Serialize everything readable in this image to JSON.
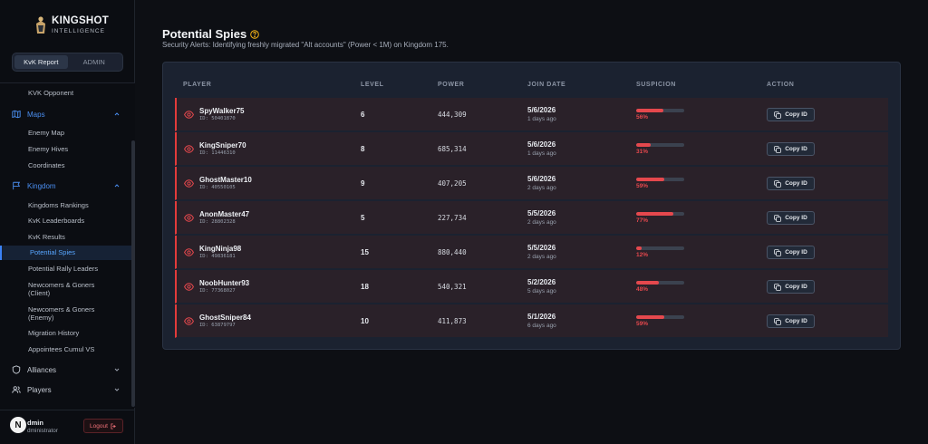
{
  "brand": {
    "line1": "KINGSHOT",
    "line2": "INTELLIGENCE"
  },
  "mode_switch": {
    "kvk_report": "KvK Report",
    "admin": "ADMIN"
  },
  "sidebar": {
    "kvk_opponent": "KVK Opponent",
    "maps": {
      "label": "Maps",
      "items": [
        "Enemy Map",
        "Enemy Hives",
        "Coordinates"
      ]
    },
    "kingdom": {
      "label": "Kingdom",
      "items": [
        "Kingdoms Rankings",
        "KvK Leaderboards",
        "KvK Results",
        "Potential Spies",
        "Potential Rally Leaders",
        "Newcomers & Goners",
        "(Client)",
        "Newcomers & Goners",
        "(Enemy)",
        "Migration History",
        "Appointees Cumul VS"
      ]
    },
    "alliances": "Alliances",
    "players": "Players"
  },
  "user": {
    "avatar": "N",
    "name": "dmin",
    "role": "dministrator",
    "logout": "Logout"
  },
  "page": {
    "title": "Potential Spies",
    "subtitle": "Security Alerts: Identifying freshly migrated \"Alt accounts\" (Power < 1M) on Kingdom 175."
  },
  "table": {
    "headers": [
      "PLAYER",
      "LEVEL",
      "POWER",
      "JOIN DATE",
      "SUSPICION",
      "ACTION"
    ],
    "copy_label": "Copy ID",
    "rows": [
      {
        "name": "SpyWalker75",
        "id": "ID: 50401870",
        "level": "6",
        "power": "444,309",
        "date": "5/6/2026",
        "ago": "1 days ago",
        "suspicion": 56,
        "suspicion_label": "56%"
      },
      {
        "name": "KingSniper70",
        "id": "ID: 11446310",
        "level": "8",
        "power": "685,314",
        "date": "5/6/2026",
        "ago": "1 days ago",
        "suspicion": 31,
        "suspicion_label": "31%"
      },
      {
        "name": "GhostMaster10",
        "id": "ID: 40550105",
        "level": "9",
        "power": "407,205",
        "date": "5/6/2026",
        "ago": "2 days ago",
        "suspicion": 59,
        "suspicion_label": "59%"
      },
      {
        "name": "AnonMaster47",
        "id": "ID: 28802328",
        "level": "5",
        "power": "227,734",
        "date": "5/5/2026",
        "ago": "2 days ago",
        "suspicion": 77,
        "suspicion_label": "77%"
      },
      {
        "name": "KingNinja98",
        "id": "ID: 49836181",
        "level": "15",
        "power": "880,440",
        "date": "5/5/2026",
        "ago": "2 days ago",
        "suspicion": 12,
        "suspicion_label": "12%"
      },
      {
        "name": "NoobHunter93",
        "id": "ID: 77368027",
        "level": "18",
        "power": "540,321",
        "date": "5/2/2026",
        "ago": "5 days ago",
        "suspicion": 48,
        "suspicion_label": "48%"
      },
      {
        "name": "GhostSniper84",
        "id": "ID: 63879797",
        "level": "10",
        "power": "411,873",
        "date": "5/1/2026",
        "ago": "6 days ago",
        "suspicion": 59,
        "suspicion_label": "59%"
      }
    ]
  },
  "colors": {
    "accent": "#3b82f6",
    "danger": "#e5484d",
    "row_bg": "#2a2129",
    "panel_bg": "#1b2230"
  },
  "icons": [
    "kingshot-logo-icon",
    "map-icon",
    "flag-icon",
    "shield-icon",
    "users-icon",
    "eye-icon",
    "copy-icon",
    "help-icon",
    "logout-icon",
    "chevron-icon"
  ]
}
